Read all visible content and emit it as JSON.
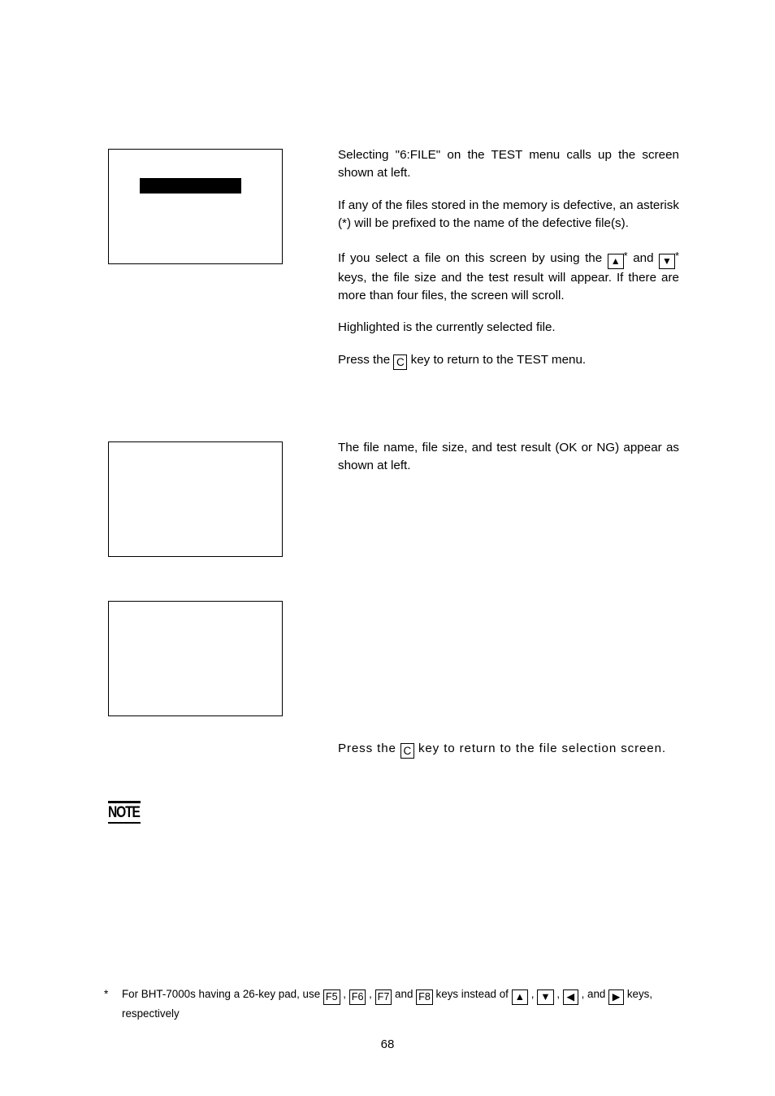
{
  "page": {
    "number": "68"
  },
  "screens": [
    {
      "name": "file-selection-screen",
      "highlight_present": true,
      "lines": []
    },
    {
      "name": "file-detail-screen",
      "highlight_present": false,
      "lines": []
    },
    {
      "name": "file-detail-screen-2",
      "highlight_present": false,
      "lines": []
    }
  ],
  "body": {
    "block_a": {
      "p1_part1": "Selecting \"6:FILE\" on the TEST menu calls up the screen shown at left.",
      "p2_part1": "If any of the files stored in the memory is defective, an asterisk (*) will be prefixed to the name of the defective file(s).",
      "p3_part1": "If you select a file on this screen by using the ",
      "p3_key_up": "▲",
      "p3_asterisk_1": "*",
      "p3_part2": " and ",
      "p3_key_down": "▼",
      "p3_asterisk_2": "*",
      "p3_part3": " keys, the file size and the test result will appear.  If there are more than four files, the screen will scroll.",
      "p4_part1": "Highlighted is the currently selected file.",
      "p5_part1": "Press the ",
      "p5_key_c": "C",
      "p5_part2": " key to return to the TEST menu."
    },
    "block_b": {
      "p1_part1": "The file name, file size, and test result (OK or NG) appear as shown at left."
    },
    "block_c": {
      "p1_part1": "Press the ",
      "p1_key_c": "C",
      "p1_part2": " key to return to the file selection screen."
    }
  },
  "note": {
    "label": "NOTE"
  },
  "footnote": {
    "marker": "*",
    "part1": "For BHT-7000s having a 26-key pad, use ",
    "key_f5": "F5",
    "sep1": " , ",
    "key_f6": "F6",
    "sep2": " , ",
    "key_f7": "F7",
    "sep3": " and ",
    "key_f8": "F8",
    "part2": " keys instead of ",
    "key_up": "▲",
    "sep4": " , ",
    "key_down": "▼",
    "sep5": " , ",
    "key_left": "◀",
    "sep6": " , and ",
    "key_right": "▶",
    "part3": " keys, respectively"
  },
  "colors": {
    "ink": "#000000",
    "paper": "#ffffff"
  }
}
